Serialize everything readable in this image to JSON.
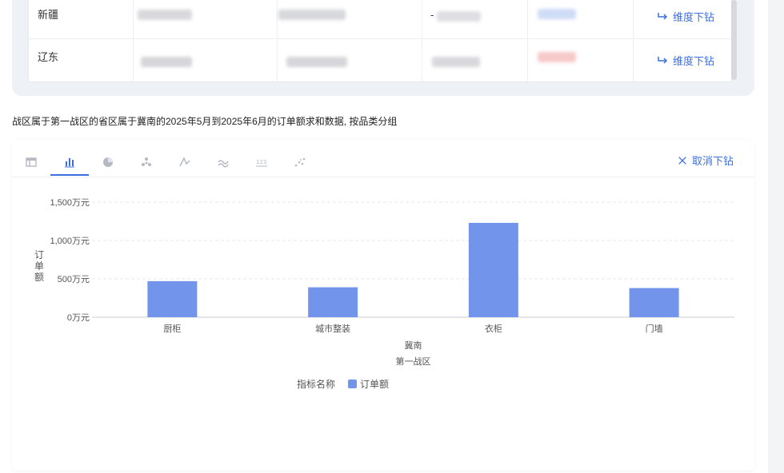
{
  "table": {
    "rows": [
      {
        "region": "新疆",
        "value3": "-",
        "drill_label": "维度下钻"
      },
      {
        "region": "辽东",
        "drill_label": "维度下钻"
      }
    ]
  },
  "description": "战区属于第一战区的省区属于冀南的2025年5月到2025年6月的订单额求和数据, 按品类分组",
  "toolbar": {
    "cancel_drill_label": "取消下钻",
    "tabs": [
      "table-icon",
      "bar-chart-icon",
      "pie-chart-icon",
      "cluster-icon",
      "line-chart-icon",
      "area-chart-icon",
      "number-icon",
      "scatter-icon"
    ],
    "active_tab_index": 1
  },
  "chart_data": {
    "type": "bar",
    "categories": [
      "厨柜",
      "城市整装",
      "衣柜",
      "门墙"
    ],
    "series": [
      {
        "name": "订单额",
        "values": [
          470,
          390,
          1230,
          380
        ],
        "color": "#7294eb"
      }
    ],
    "yticks": [
      "0万元",
      "500万元",
      "1,000万元",
      "1,500万元"
    ],
    "ylim": [
      0,
      1500
    ],
    "ylabel": "订单额",
    "xlabel_levels": [
      "冀南",
      "第一战区"
    ],
    "legend_title": "指标名称",
    "legend_placement": "bottom-center",
    "grid": true
  }
}
